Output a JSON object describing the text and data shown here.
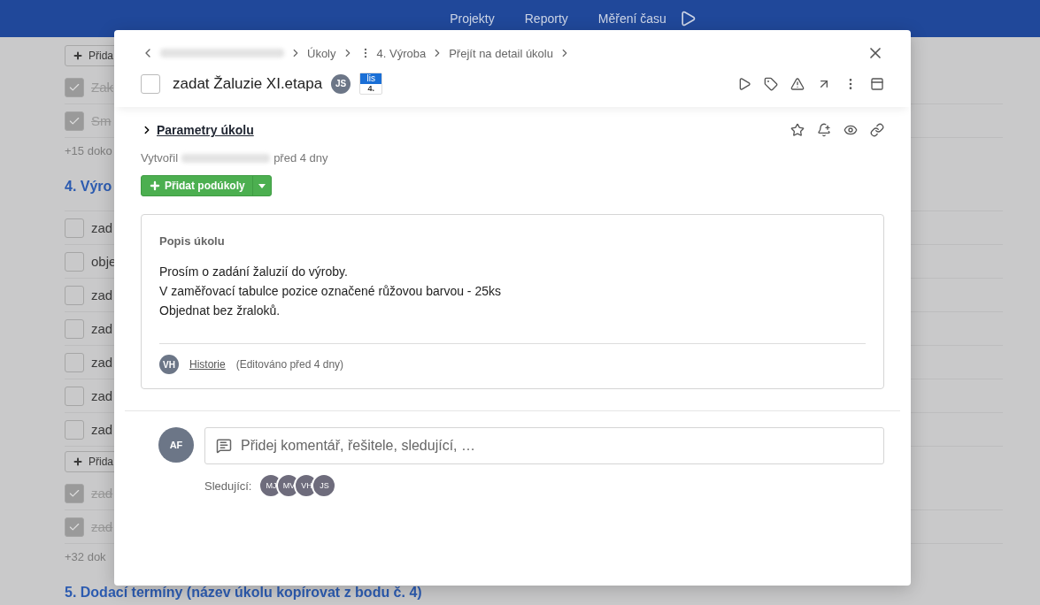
{
  "nav": {
    "items": [
      "Projekty",
      "Reporty",
      "Měření času"
    ]
  },
  "background": {
    "items": [
      {
        "kind": "button",
        "label": "Přida"
      },
      {
        "kind": "task",
        "label": "Zak",
        "checked": true
      },
      {
        "kind": "task",
        "label": "Sm",
        "checked": true
      },
      {
        "kind": "more",
        "label": "+15 doko"
      },
      {
        "kind": "heading",
        "label": "4. Výro"
      },
      {
        "kind": "task",
        "label": "zad",
        "checked": false
      },
      {
        "kind": "task",
        "label": "obje",
        "checked": false
      },
      {
        "kind": "task",
        "label": "zad",
        "checked": false
      },
      {
        "kind": "task",
        "label": "zad",
        "checked": false
      },
      {
        "kind": "task",
        "label": "zad",
        "checked": false
      },
      {
        "kind": "task",
        "label": "zad",
        "checked": false
      },
      {
        "kind": "task",
        "label": "zad",
        "checked": false
      },
      {
        "kind": "button",
        "label": "Přida"
      },
      {
        "kind": "task",
        "label": "zad",
        "checked": true
      },
      {
        "kind": "task",
        "label": "zad",
        "checked": true
      },
      {
        "kind": "more",
        "label": "+32 dok"
      },
      {
        "kind": "heading",
        "label": "5. Dodací termíny (název úkolu kopírovat z bodu č. 4)"
      }
    ]
  },
  "modal": {
    "breadcrumb": [
      "Úkoly",
      "4. Výroba",
      "Přejít na detail úkolu"
    ],
    "task": {
      "title": "zadat Žaluzie XI.etapa",
      "checked": false,
      "assignee": "JS",
      "date": {
        "month": "lis",
        "day": "4."
      }
    },
    "parameters": {
      "label": "Parametry úkolu",
      "expanded": false
    },
    "created": {
      "prefix": "Vytvořil",
      "suffix": "před 4 dny"
    },
    "add_subtasks": "Přidat podúkoly",
    "description": {
      "title": "Popis úkolu",
      "lines": [
        "Prosím o zadání žaluzií do výroby.",
        "V zaměřovací tabulce pozice označené růžovou barvou - 25ks",
        "Objednat bez žraloků."
      ],
      "editor": "VH",
      "history": "Historie",
      "edited": "(Editováno před 4 dny)"
    },
    "comment": {
      "avatar": "AF",
      "placeholder": "Přidej komentář, řešitele, sledující, …"
    },
    "followers": {
      "label": "Sledující:",
      "people": [
        "MJ",
        "MV",
        "VH",
        "JS"
      ]
    }
  }
}
